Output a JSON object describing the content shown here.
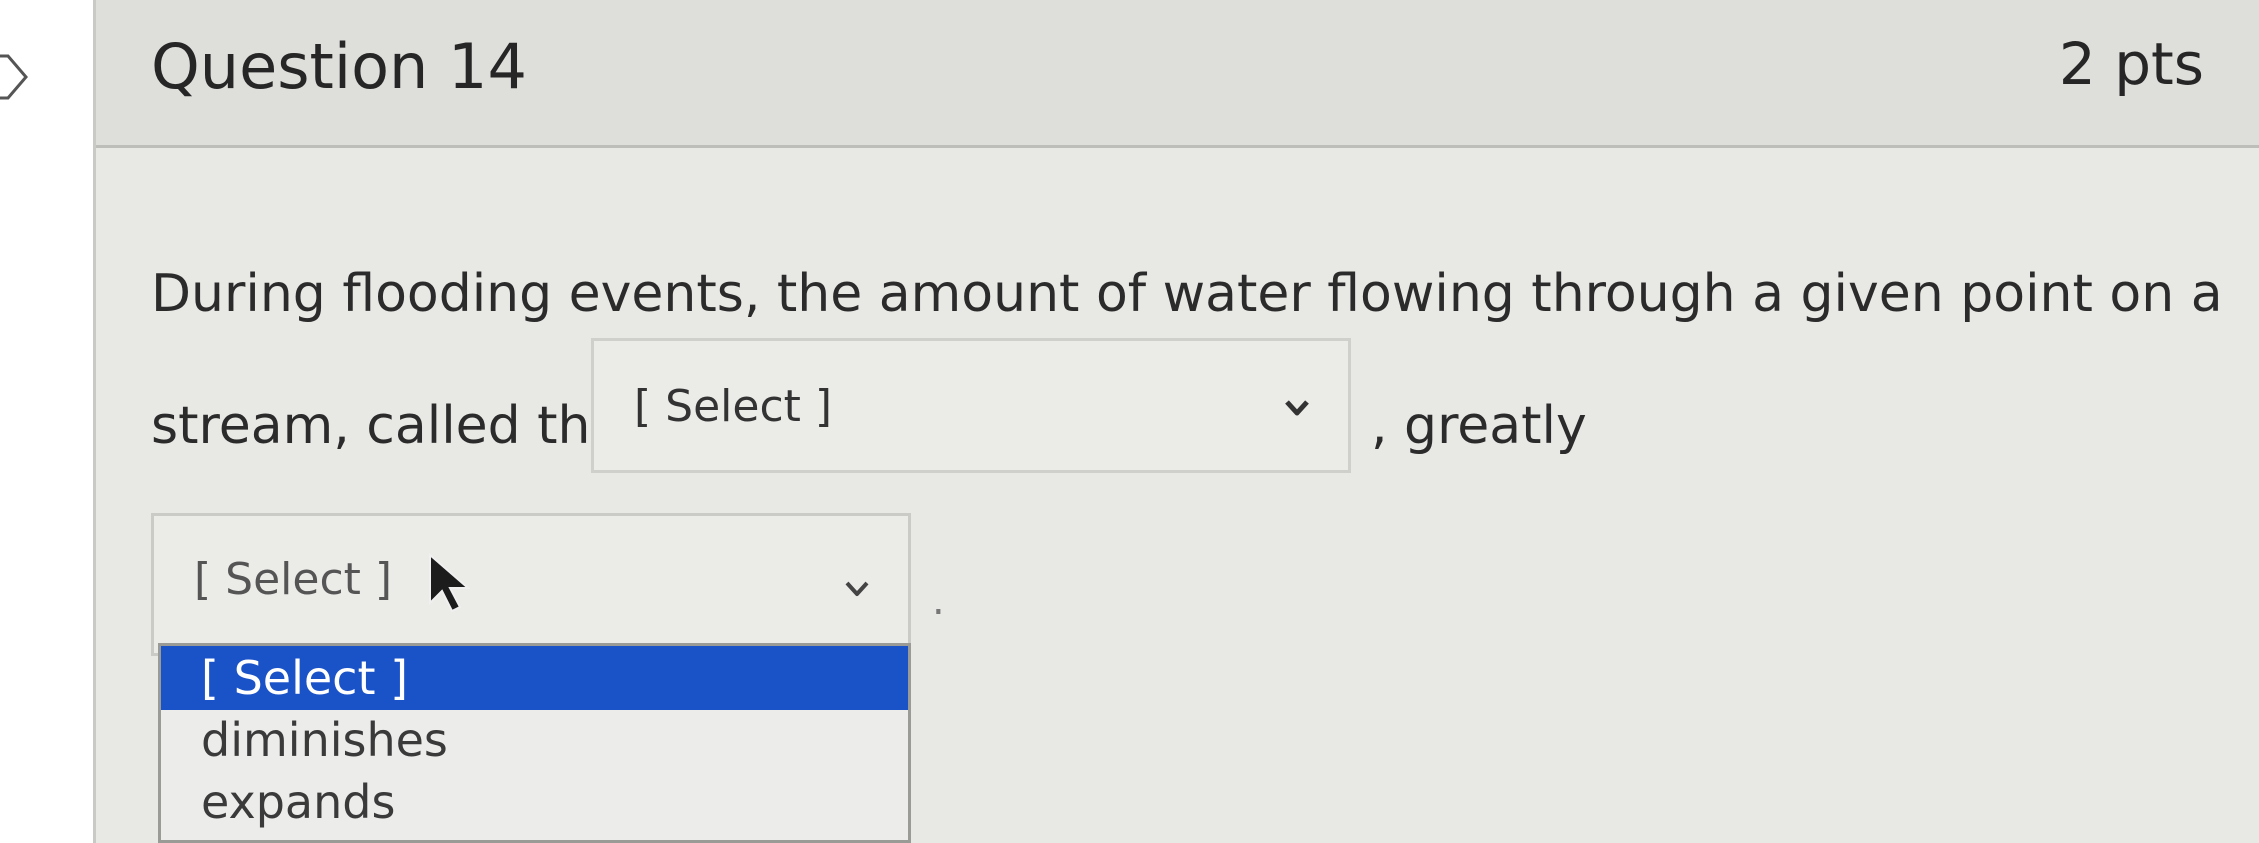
{
  "question": {
    "title": "Question 14",
    "points": "2 pts"
  },
  "body": {
    "line1": "During flooding events, the amount of water flowing through a given point on a",
    "line2_before": "stream, called the",
    "line2_after": ", greatly",
    "trailing_punct": "."
  },
  "select1": {
    "value": "[ Select ]",
    "icon": "chevron-down-icon"
  },
  "select2": {
    "value": "[ Select ]",
    "icon": "chevron-down-icon",
    "options": [
      "[ Select ]",
      "diminishes",
      "expands"
    ],
    "highlighted_index": 0
  },
  "colors": {
    "highlight": "#1a52c8",
    "text": "#2b2b2b"
  }
}
